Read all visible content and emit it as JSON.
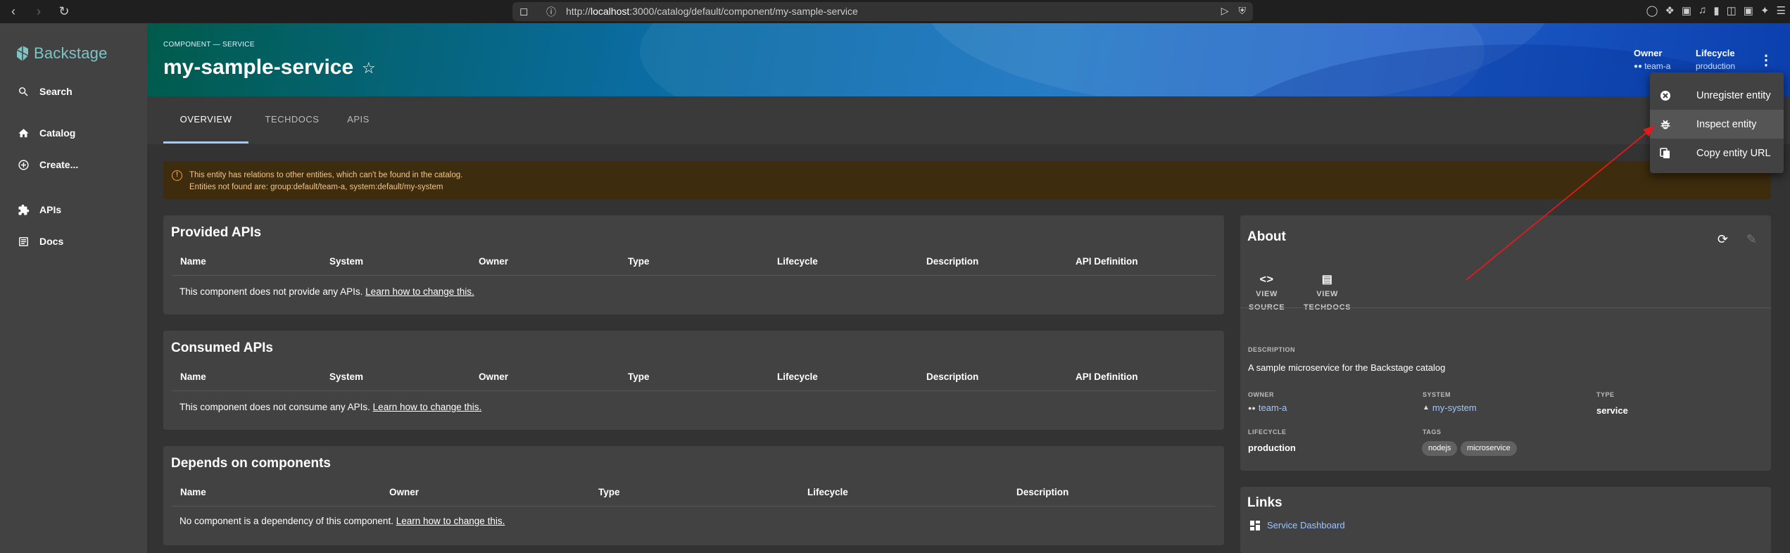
{
  "browser": {
    "url_prefix": "http://",
    "url_host": "localhost",
    "url_rest": ":3000/catalog/default/component/my-sample-service"
  },
  "sidebar": {
    "logo_text": "Backstage",
    "items": [
      {
        "label": "Search",
        "icon": "search-icon"
      },
      {
        "label": "Catalog",
        "icon": "home-icon"
      },
      {
        "label": "Create...",
        "icon": "add-circle-icon"
      },
      {
        "label": "APIs",
        "icon": "puzzle-icon"
      },
      {
        "label": "Docs",
        "icon": "docs-icon"
      }
    ]
  },
  "header": {
    "kicker": "COMPONENT — SERVICE",
    "title": "my-sample-service",
    "owner_label": "Owner",
    "owner_value": "team-a",
    "lifecycle_label": "Lifecycle",
    "lifecycle_value": "production"
  },
  "tabs": [
    {
      "label": "OVERVIEW",
      "active": true
    },
    {
      "label": "TECHDOCS",
      "active": false
    },
    {
      "label": "APIS",
      "active": false
    }
  ],
  "warning": {
    "line1": "This entity has relations to other entities, which can't be found in the catalog.",
    "line2": "Entities not found are: group:default/team-a, system:default/my-system"
  },
  "provided_apis": {
    "title": "Provided APIs",
    "columns": [
      "Name",
      "System",
      "Owner",
      "Type",
      "Lifecycle",
      "Description",
      "API Definition"
    ],
    "empty_text": "This component does not provide any APIs.",
    "link_text": "Learn how to change this."
  },
  "consumed_apis": {
    "title": "Consumed APIs",
    "columns": [
      "Name",
      "System",
      "Owner",
      "Type",
      "Lifecycle",
      "Description",
      "API Definition"
    ],
    "empty_text": "This component does not consume any APIs.",
    "link_text": "Learn how to change this."
  },
  "depends_on": {
    "title": "Depends on components",
    "columns": [
      "Name",
      "Owner",
      "Type",
      "Lifecycle",
      "Description"
    ],
    "empty_text": "No component is a dependency of this component.",
    "link_text": "Learn how to change this."
  },
  "about": {
    "title": "About",
    "view_source_1": "VIEW",
    "view_source_2": "SOURCE",
    "view_techdocs_1": "VIEW",
    "view_techdocs_2": "TECHDOCS",
    "description_label": "DESCRIPTION",
    "description": "A sample microservice for the Backstage catalog",
    "owner_label": "OWNER",
    "owner": "team-a",
    "system_label": "SYSTEM",
    "system": "my-system",
    "type_label": "TYPE",
    "type": "service",
    "lifecycle_label": "LIFECYCLE",
    "lifecycle": "production",
    "tags_label": "TAGS",
    "tags": [
      "nodejs",
      "microservice"
    ]
  },
  "links": {
    "title": "Links",
    "items": [
      {
        "label": "Service Dashboard",
        "icon": "dashboard-icon"
      }
    ]
  },
  "menu": {
    "items": [
      {
        "label": "Unregister entity",
        "icon": "cancel-icon"
      },
      {
        "label": "Inspect entity",
        "icon": "bug-icon",
        "highlighted": true
      },
      {
        "label": "Copy entity URL",
        "icon": "copy-icon"
      }
    ]
  },
  "colors": {
    "accent_link": "#9ec5ff",
    "warning_bg": "#3d2c0d",
    "annotation_arrow": "#e01b1b"
  }
}
